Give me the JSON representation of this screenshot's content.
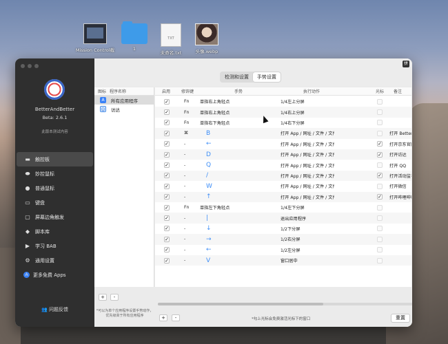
{
  "desktop": {
    "icons": [
      {
        "label": "Mission Control截"
      },
      {
        "label": "1"
      },
      {
        "label": "未命名.txt",
        "doc_text": "TXT"
      },
      {
        "label": "头像.webp"
      }
    ]
  },
  "window": {
    "sidebar": {
      "app_name": "BetterAndBetter",
      "version": "Beta: 2.6.1",
      "note": "此版本测试内容",
      "nav": [
        {
          "label": "触控板",
          "icon": "trackpad-icon",
          "glyph": "▬"
        },
        {
          "label": "妙控鼠标",
          "icon": "mouse-icon",
          "glyph": "⬬"
        },
        {
          "label": "普通鼠标",
          "icon": "normal-mouse-icon",
          "glyph": "●"
        },
        {
          "label": "键盘",
          "icon": "keyboard-icon",
          "glyph": "▭"
        },
        {
          "label": "屏幕边角触发",
          "icon": "screen-corner-icon",
          "glyph": "▢"
        },
        {
          "label": "脚本库",
          "icon": "script-icon",
          "glyph": "◆"
        },
        {
          "label": "学习 BAB",
          "icon": "play-icon",
          "glyph": "▶"
        },
        {
          "label": "通用设置",
          "icon": "gear-icon",
          "glyph": "⚙"
        },
        {
          "label": "更多免费 Apps",
          "icon": "appstore-icon",
          "glyph": "A"
        }
      ],
      "feedback": "问题反馈"
    },
    "lang_button": "拼",
    "tabs": [
      {
        "label": "检测和设置",
        "selected": false
      },
      {
        "label": "手势设置",
        "selected": true
      }
    ],
    "apps_panel": {
      "headers": {
        "icon": "图标",
        "name": "程序名称"
      },
      "rows": [
        {
          "name": "所有应用程序",
          "selected": true
        },
        {
          "name": "访达",
          "selected": false
        }
      ],
      "add": "+",
      "remove": "-",
      "hint": "*可以为单个应用程序设置手势动作，优先级高于所有应用程序"
    },
    "table": {
      "headers": {
        "enable": "启用",
        "modifier": "修饰键",
        "gesture": "手势",
        "action": "执行动作",
        "cursor": "光标",
        "note": "备注"
      },
      "rows": [
        {
          "enabled": true,
          "modifier": "Fn",
          "gesture": "单指右上角轻点",
          "action": "1/4左上分屏",
          "cursor": false,
          "note": ""
        },
        {
          "enabled": true,
          "modifier": "Fn",
          "gesture": "单指右上角轻点",
          "action": "1/4右上分屏",
          "cursor": false,
          "note": ""
        },
        {
          "enabled": true,
          "modifier": "Fn",
          "gesture": "单指右下角轻点",
          "action": "1/4右下分屏",
          "cursor": false,
          "note": ""
        },
        {
          "enabled": true,
          "modifier": "⌘",
          "gesture": "B",
          "action": "打开 App / 网址 / 文件 / 文件夹...",
          "cursor": false,
          "note": "打开 BetterDisplay"
        },
        {
          "enabled": true,
          "modifier": "-",
          "gesture": "←",
          "action": "打开 App / 网址 / 文件 / 文件夹...",
          "cursor": true,
          "note": "打开京东官网"
        },
        {
          "enabled": true,
          "modifier": "-",
          "gesture": "D",
          "action": "打开 App / 网址 / 文件 / 文件夹...",
          "cursor": true,
          "note": "打开访达"
        },
        {
          "enabled": true,
          "modifier": "-",
          "gesture": "Q",
          "action": "打开 App / 网址 / 文件 / 文件夹...",
          "cursor": false,
          "note": "打开 QQ"
        },
        {
          "enabled": true,
          "modifier": "-",
          "gesture": "/",
          "action": "打开 App / 网址 / 文件 / 文件夹...",
          "cursor": true,
          "note": "打开活动监视器"
        },
        {
          "enabled": true,
          "modifier": "-",
          "gesture": "W",
          "action": "打开 App / 网址 / 文件 / 文件夹...",
          "cursor": false,
          "note": "打开微信"
        },
        {
          "enabled": true,
          "modifier": "-",
          "gesture": "↑",
          "action": "打开 App / 网址 / 文件 / 文件夹...",
          "cursor": true,
          "note": "打开哔哩哔哩"
        },
        {
          "enabled": true,
          "modifier": "Fn",
          "gesture": "单指左下角轻点",
          "action": "1/4左下分屏",
          "cursor": false,
          "note": ""
        },
        {
          "enabled": true,
          "modifier": "-",
          "gesture": "|",
          "action": "退出应用程序",
          "cursor": false,
          "note": ""
        },
        {
          "enabled": true,
          "modifier": "-",
          "gesture": "↓",
          "action": "1/2下分屏",
          "cursor": false,
          "note": ""
        },
        {
          "enabled": true,
          "modifier": "-",
          "gesture": "→",
          "action": "1/2右分屏",
          "cursor": false,
          "note": ""
        },
        {
          "enabled": true,
          "modifier": "-",
          "gesture": "←",
          "action": "1/2左分屏",
          "cursor": false,
          "note": ""
        },
        {
          "enabled": true,
          "modifier": "-",
          "gesture": "V",
          "action": "窗口居中",
          "cursor": false,
          "note": ""
        }
      ],
      "add": "+",
      "remove": "-",
      "footer_hint": "*勾上光标会免费激活光标下的窗口",
      "reset": "重置"
    },
    "colors": {
      "sidebar": "#2f2f2f",
      "accent": "#3e8ef7"
    }
  }
}
